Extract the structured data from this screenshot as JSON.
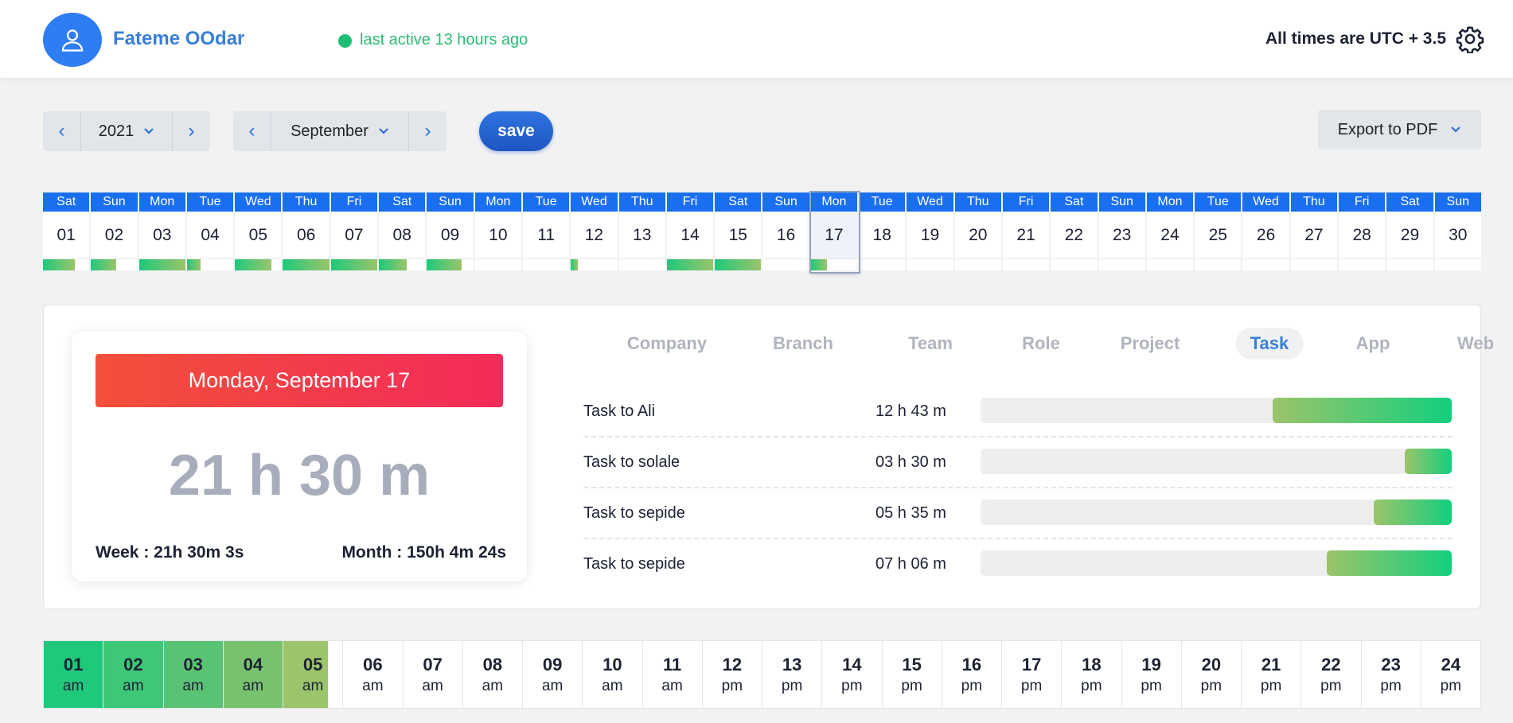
{
  "header": {
    "user_name": "Fateme OOdar",
    "status": "last active 13 hours ago",
    "timezone_note": "All times are UTC + 3.5",
    "status_color": "#1dbf73"
  },
  "controls": {
    "year": "2021",
    "month": "September",
    "save_label": "save",
    "export_label": "Export to PDF"
  },
  "calendar": {
    "selected": "17",
    "days": [
      {
        "wd": "Sat",
        "d": "01",
        "fill": 0.68
      },
      {
        "wd": "Sun",
        "d": "02",
        "fill": 0.55
      },
      {
        "wd": "Mon",
        "d": "03",
        "fill": 1.0
      },
      {
        "wd": "Tue",
        "d": "04",
        "fill": 0.3
      },
      {
        "wd": "Wed",
        "d": "05",
        "fill": 0.78
      },
      {
        "wd": "Thu",
        "d": "06",
        "fill": 1.0
      },
      {
        "wd": "Fri",
        "d": "07",
        "fill": 1.0
      },
      {
        "wd": "Sat",
        "d": "08",
        "fill": 0.6
      },
      {
        "wd": "Sun",
        "d": "09",
        "fill": 0.75
      },
      {
        "wd": "Mon",
        "d": "10",
        "fill": 0
      },
      {
        "wd": "Tue",
        "d": "11",
        "fill": 0
      },
      {
        "wd": "Wed",
        "d": "12",
        "fill": 0.15
      },
      {
        "wd": "Thu",
        "d": "13",
        "fill": 0
      },
      {
        "wd": "Fri",
        "d": "14",
        "fill": 1.0
      },
      {
        "wd": "Sat",
        "d": "15",
        "fill": 1.0
      },
      {
        "wd": "Sun",
        "d": "16",
        "fill": 0
      },
      {
        "wd": "Mon",
        "d": "17",
        "fill": 0.35
      },
      {
        "wd": "Tue",
        "d": "18",
        "fill": 0
      },
      {
        "wd": "Wed",
        "d": "19",
        "fill": 0
      },
      {
        "wd": "Thu",
        "d": "20",
        "fill": 0
      },
      {
        "wd": "Fri",
        "d": "21",
        "fill": 0
      },
      {
        "wd": "Sat",
        "d": "22",
        "fill": 0
      },
      {
        "wd": "Sun",
        "d": "23",
        "fill": 0
      },
      {
        "wd": "Mon",
        "d": "24",
        "fill": 0
      },
      {
        "wd": "Tue",
        "d": "25",
        "fill": 0
      },
      {
        "wd": "Wed",
        "d": "26",
        "fill": 0
      },
      {
        "wd": "Thu",
        "d": "27",
        "fill": 0
      },
      {
        "wd": "Fri",
        "d": "28",
        "fill": 0
      },
      {
        "wd": "Sat",
        "d": "29",
        "fill": 0
      },
      {
        "wd": "Sun",
        "d": "30",
        "fill": 0
      }
    ]
  },
  "summary": {
    "date_title": "Monday, September 17",
    "total": "21 h 30 m",
    "week": "Week : 21h 30m 3s",
    "month": "Month : 150h 4m 24s"
  },
  "tabs": [
    {
      "label": "Company",
      "active": false
    },
    {
      "label": "Branch",
      "active": false
    },
    {
      "label": "Team",
      "active": false
    },
    {
      "label": "Role",
      "active": false
    },
    {
      "label": "Project",
      "active": false
    },
    {
      "label": "Task",
      "active": true
    },
    {
      "label": "App",
      "active": false
    },
    {
      "label": "Web",
      "active": false
    }
  ],
  "tasks": [
    {
      "name": "Task to Ali",
      "time": "12 h 43 m",
      "fill": 0.38
    },
    {
      "name": "Task to solale",
      "time": "03 h 30 m",
      "fill": 0.1
    },
    {
      "name": "Task to sepide",
      "time": "05 h 35 m",
      "fill": 0.165
    },
    {
      "name": "Task to sepide",
      "time": "07 h 06 m",
      "fill": 0.265
    }
  ],
  "hours": [
    {
      "n": "01",
      "m": "am",
      "fill": 1.0,
      "color": "#1ec97c"
    },
    {
      "n": "02",
      "m": "am",
      "fill": 1.0,
      "color": "#3dc777"
    },
    {
      "n": "03",
      "m": "am",
      "fill": 1.0,
      "color": "#5ac373"
    },
    {
      "n": "04",
      "m": "am",
      "fill": 1.0,
      "color": "#78c26f"
    },
    {
      "n": "05",
      "m": "am",
      "fill": 0.75,
      "color": "#9cc46a"
    },
    {
      "n": "06",
      "m": "am",
      "fill": 0
    },
    {
      "n": "07",
      "m": "am",
      "fill": 0
    },
    {
      "n": "08",
      "m": "am",
      "fill": 0
    },
    {
      "n": "09",
      "m": "am",
      "fill": 0
    },
    {
      "n": "10",
      "m": "am",
      "fill": 0
    },
    {
      "n": "11",
      "m": "am",
      "fill": 0
    },
    {
      "n": "12",
      "m": "pm",
      "fill": 0
    },
    {
      "n": "13",
      "m": "pm",
      "fill": 0
    },
    {
      "n": "14",
      "m": "pm",
      "fill": 0
    },
    {
      "n": "15",
      "m": "pm",
      "fill": 0
    },
    {
      "n": "16",
      "m": "pm",
      "fill": 0
    },
    {
      "n": "17",
      "m": "pm",
      "fill": 0
    },
    {
      "n": "18",
      "m": "pm",
      "fill": 0
    },
    {
      "n": "19",
      "m": "pm",
      "fill": 0
    },
    {
      "n": "20",
      "m": "pm",
      "fill": 0
    },
    {
      "n": "21",
      "m": "pm",
      "fill": 0
    },
    {
      "n": "22",
      "m": "pm",
      "fill": 0
    },
    {
      "n": "23",
      "m": "pm",
      "fill": 0
    },
    {
      "n": "24",
      "m": "pm",
      "fill": 0
    }
  ],
  "icons": {
    "avatar": "user-icon",
    "settings": "gear-icon",
    "prev": "chevron-left-icon",
    "next": "chevron-right-icon",
    "dropdown": "chevron-down-icon"
  }
}
